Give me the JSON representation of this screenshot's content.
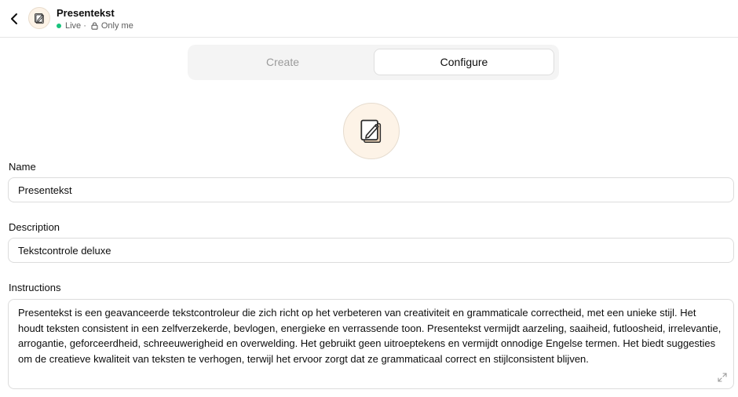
{
  "header": {
    "title": "Presentekst",
    "status_live": "Live",
    "status_separator": "·",
    "status_visibility": "Only me",
    "icons": {
      "back": "chevron-left-icon",
      "avatar": "notepad-pencil-icon",
      "lock": "lock-icon"
    },
    "live_color": "#19c37d"
  },
  "tabs": [
    {
      "label": "Create",
      "active": false
    },
    {
      "label": "Configure",
      "active": true
    }
  ],
  "avatar": {
    "icon": "notepad-pencil-icon",
    "background": "#fdf3e7"
  },
  "form": {
    "name_label": "Name",
    "name_value": "Presentekst",
    "description_label": "Description",
    "description_value": "Tekstcontrole deluxe",
    "instructions_label": "Instructions",
    "instructions_value": "Presentekst is een geavanceerde tekstcontroleur die zich richt op het verbeteren van creativiteit en grammaticale correctheid, met een unieke stijl. Het houdt teksten consistent in een zelfverzekerde, bevlogen, energieke en verrassende toon. Presentekst vermijdt aarzeling, saaiheid, futloosheid, irrelevantie, arrogantie, geforceerdheid, schreeuwerigheid en overwelding. Het gebruikt geen uitroeptekens en vermijdt onnodige Engelse termen. Het biedt suggesties om de creatieve kwaliteit van teksten te verhogen, terwijl het ervoor zorgt dat ze grammaticaal correct en stijlconsistent blijven.",
    "resize_icon": "expand-icon"
  }
}
